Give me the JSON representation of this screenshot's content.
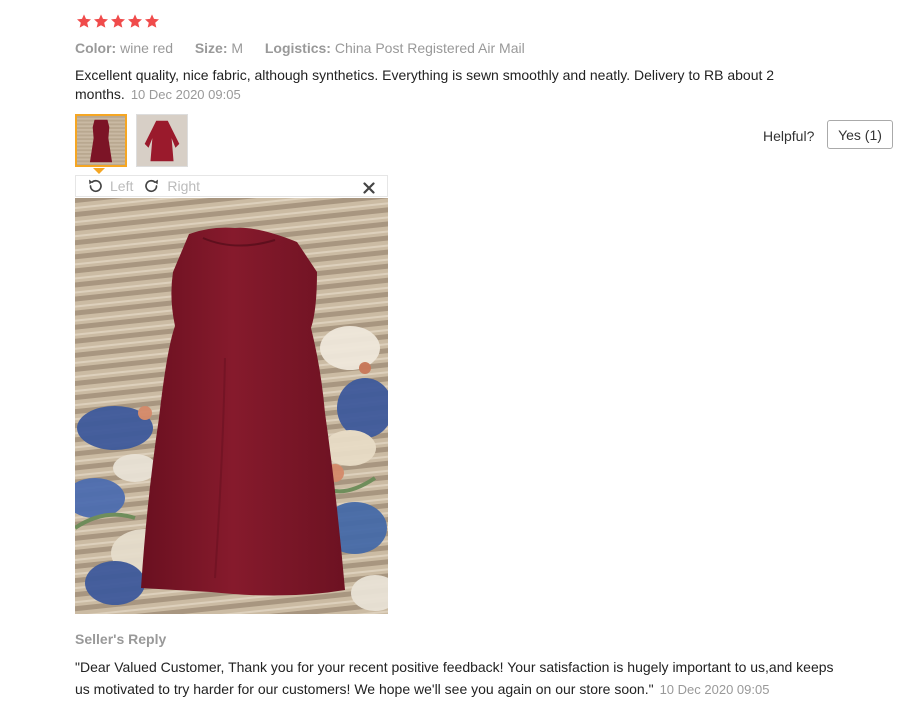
{
  "rating": {
    "stars": 5,
    "color": "#f04b4b"
  },
  "attributes": [
    {
      "label": "Color:",
      "value": "wine red"
    },
    {
      "label": "Size:",
      "value": "M"
    },
    {
      "label": "Logistics:",
      "value": "China Post Registered Air Mail"
    }
  ],
  "review": {
    "text": "Excellent quality, nice fabric, although synthetics. Everything is sewn smoothly and neatly. Delivery to RB about 2 months.",
    "date": "10 Dec 2020 09:05"
  },
  "helpful": {
    "label": "Helpful?",
    "button": "Yes (1)"
  },
  "viewer": {
    "rotate_left": "Left",
    "rotate_right": "Right",
    "close_symbol": "×"
  },
  "seller_reply": {
    "title": "Seller's Reply",
    "text": "\"Dear Valued Customer, Thank you for your recent positive feedback! Your satisfaction is hugely important to us,and keeps us motivated to try harder for our customers! We hope we'll see you again on our store soon.\"",
    "date": "10 Dec 2020 09:05"
  }
}
